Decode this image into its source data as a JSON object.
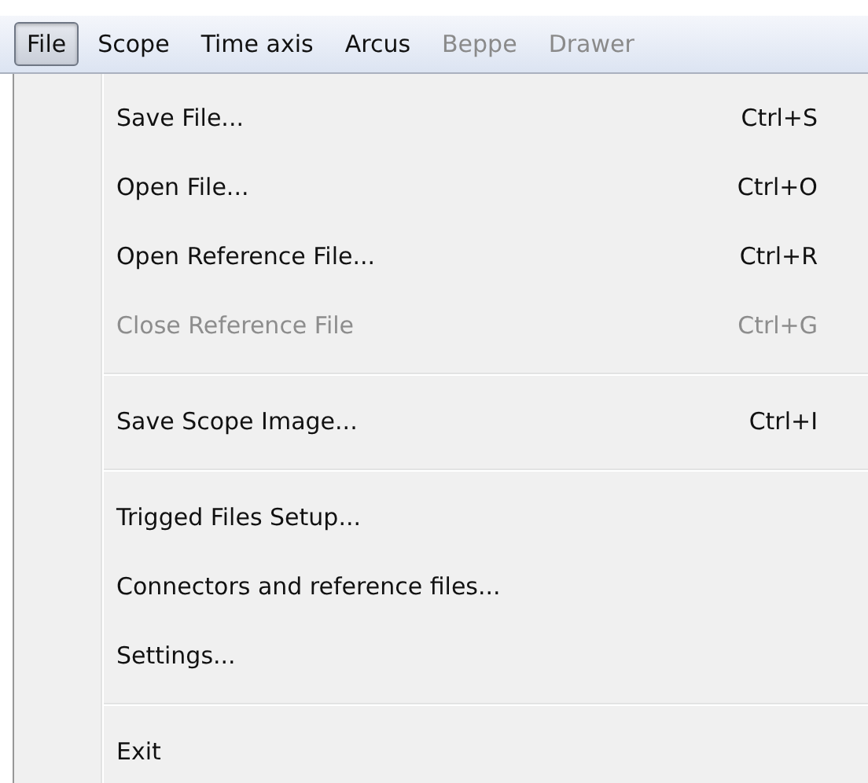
{
  "menu_bar": [
    {
      "label": "File",
      "selected": true,
      "disabled": false
    },
    {
      "label": "Scope",
      "selected": false,
      "disabled": false
    },
    {
      "label": "Time axis",
      "selected": false,
      "disabled": false
    },
    {
      "label": "Arcus",
      "selected": false,
      "disabled": false
    },
    {
      "label": "Beppe",
      "selected": false,
      "disabled": true
    },
    {
      "label": "Drawer",
      "selected": false,
      "disabled": true
    }
  ],
  "file_menu": [
    {
      "kind": "item",
      "label": "Save File...",
      "shortcut": "Ctrl+S",
      "disabled": false
    },
    {
      "kind": "item",
      "label": "Open File...",
      "shortcut": "Ctrl+O",
      "disabled": false
    },
    {
      "kind": "item",
      "label": "Open Reference File...",
      "shortcut": "Ctrl+R",
      "disabled": false
    },
    {
      "kind": "item",
      "label": "Close Reference File",
      "shortcut": "Ctrl+G",
      "disabled": true
    },
    {
      "kind": "separator"
    },
    {
      "kind": "item",
      "label": "Save Scope Image...",
      "shortcut": "Ctrl+I",
      "disabled": false
    },
    {
      "kind": "separator"
    },
    {
      "kind": "item",
      "label": "Trigged Files Setup...",
      "disabled": false
    },
    {
      "kind": "item",
      "label": "Connectors and reference files...",
      "disabled": false
    },
    {
      "kind": "item",
      "label": "Settings...",
      "disabled": false
    },
    {
      "kind": "separator"
    },
    {
      "kind": "item",
      "label": "Exit",
      "disabled": false
    }
  ]
}
